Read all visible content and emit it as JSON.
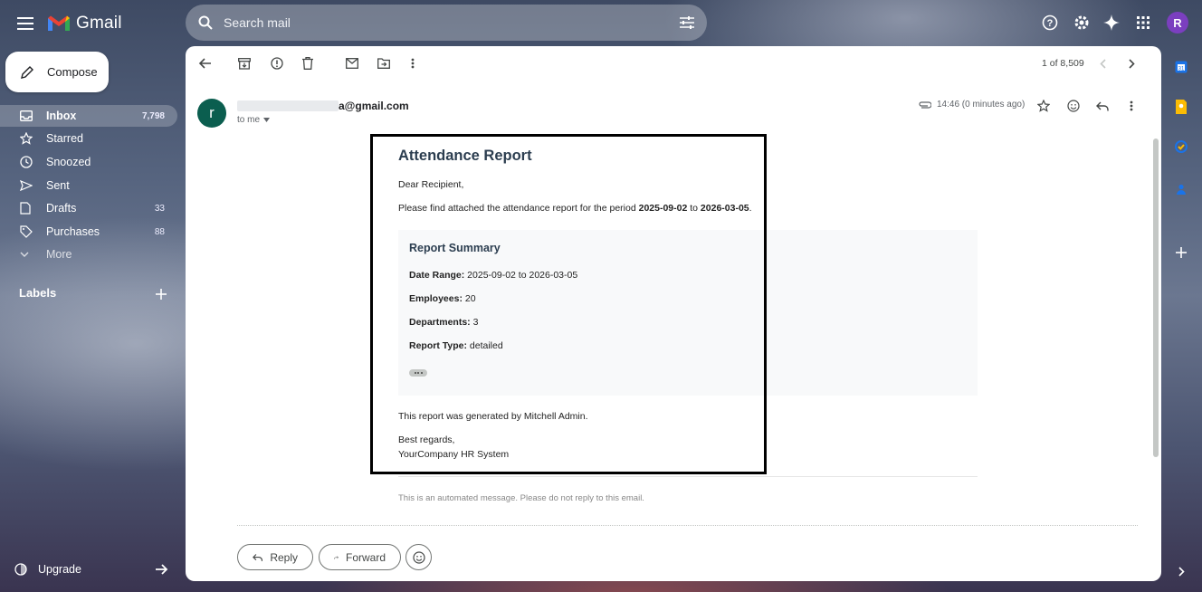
{
  "app": {
    "name": "Gmail"
  },
  "search": {
    "placeholder": "Search mail"
  },
  "account": {
    "initial": "R"
  },
  "compose": {
    "label": "Compose"
  },
  "sidebar": {
    "items": [
      {
        "label": "Inbox",
        "count": "7,798",
        "icon": "inbox-icon",
        "active": true
      },
      {
        "label": "Starred",
        "count": "",
        "icon": "star-icon"
      },
      {
        "label": "Snoozed",
        "count": "",
        "icon": "clock-icon"
      },
      {
        "label": "Sent",
        "count": "",
        "icon": "send-icon"
      },
      {
        "label": "Drafts",
        "count": "33",
        "icon": "draft-icon"
      },
      {
        "label": "Purchases",
        "count": "88",
        "icon": "tag-icon"
      },
      {
        "label": "More",
        "count": "",
        "icon": "chevron-down-icon"
      }
    ],
    "labels_heading": "Labels",
    "upgrade": "Upgrade"
  },
  "toolbar": {
    "pager": "1 of 8,509"
  },
  "message": {
    "sender_avatar": "r",
    "sender_email": "a@gmail.com",
    "to": "to me",
    "time": "14:46 (0 minutes ago)"
  },
  "report": {
    "title": "Attendance Report",
    "greeting": "Dear Recipient,",
    "intro_prefix": "Please find attached the attendance report for the period ",
    "start_date": "2025-09-02",
    "intro_mid": " to ",
    "end_date": "2026-03-05",
    "intro_suffix": ".",
    "summary": {
      "title": "Report Summary",
      "rows": [
        {
          "label": "Date Range:",
          "value": " 2025-09-02 to 2026-03-05"
        },
        {
          "label": "Employees:",
          "value": " 20"
        },
        {
          "label": "Departments:",
          "value": " 3"
        },
        {
          "label": "Report Type:",
          "value": " detailed"
        }
      ]
    },
    "generated_by": "This report was generated by Mitchell Admin.",
    "closing": "Best regards,",
    "signature": "YourCompany HR System",
    "automated_note": "This is an automated message. Please do not reply to this email."
  },
  "actions": {
    "reply": "Reply",
    "forward": "Forward"
  }
}
